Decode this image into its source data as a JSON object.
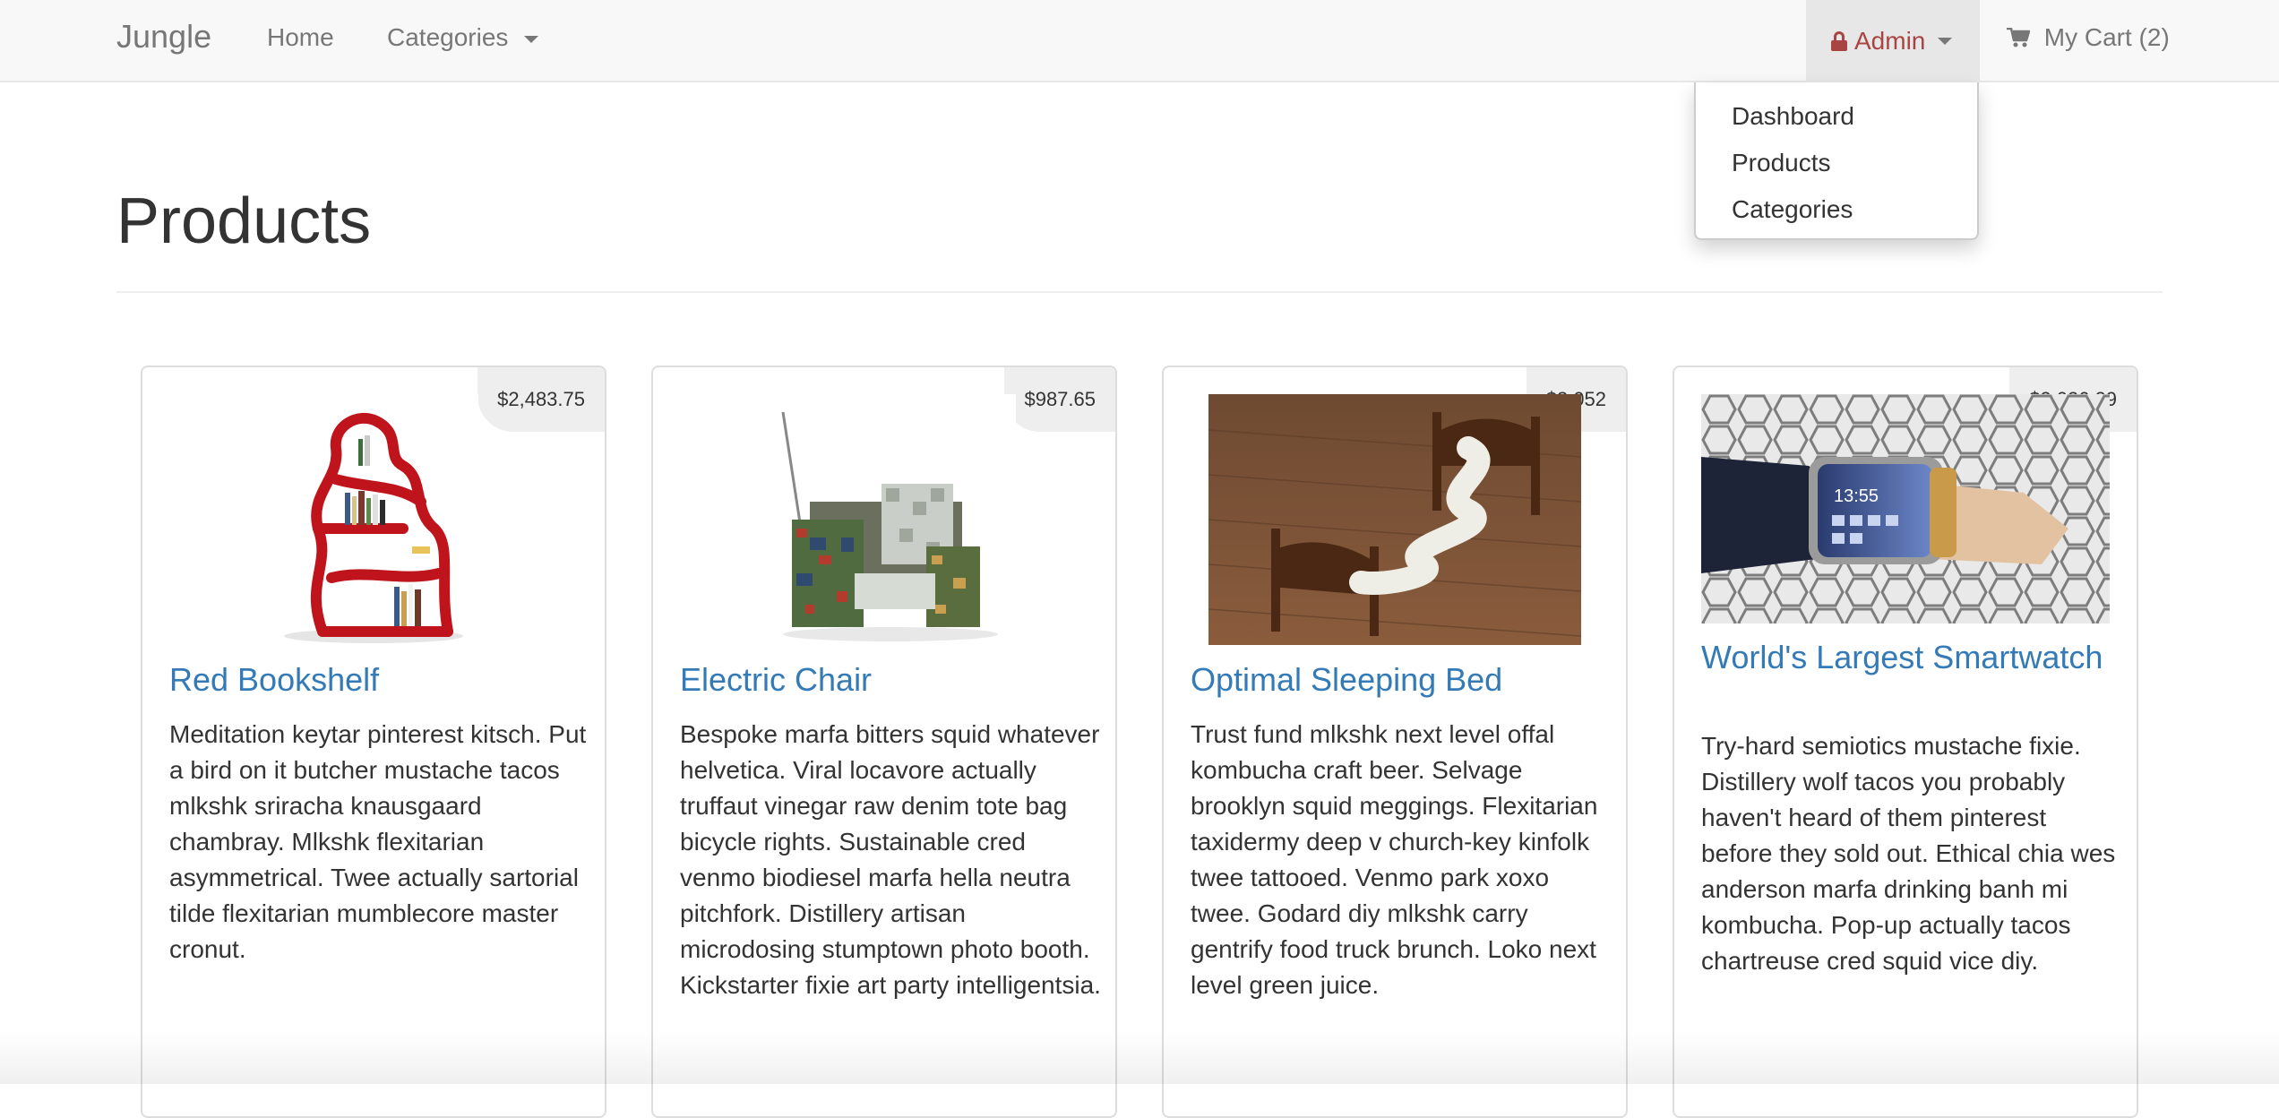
{
  "navbar": {
    "brand": "Jungle",
    "home_label": "Home",
    "categories_label": "Categories",
    "admin_label": "Admin",
    "cart_label": "My Cart (2)",
    "admin_color": "#a94442"
  },
  "admin_menu": {
    "items": [
      "Dashboard",
      "Products",
      "Categories"
    ]
  },
  "page": {
    "title": "Products"
  },
  "products": [
    {
      "name": "Red Bookshelf",
      "price": "$2,483.75",
      "description": "Meditation keytar pinterest kitsch. Put a bird on it butcher mustache tacos mlkshk sriracha knausgaard chambray. Mlkshk flexitarian asymmetrical. Twee actually sartorial tilde flexitarian mumblecore master cronut."
    },
    {
      "name": "Electric Chair",
      "price": "$987.65",
      "description": "Bespoke marfa bitters squid whatever helvetica. Viral locavore actually truffaut vinegar raw denim tote bag bicycle rights. Sustainable cred venmo biodiesel marfa hella neutra pitchfork. Distillery artisan microdosing stumptown photo booth. Kickstarter fixie art party intelligentsia."
    },
    {
      "name": "Optimal Sleeping Bed",
      "price": "$3,052",
      "description": "Trust fund mlkshk next level offal kombucha craft beer. Selvage brooklyn squid meggings. Flexitarian taxidermy deep v church-key kinfolk twee tattooed. Venmo park xoxo twee. Godard diy mlkshk carry gentrify food truck brunch. Loko next level green juice."
    },
    {
      "name": "World's Largest Smartwatch",
      "price": "$2,026.29",
      "description": "Try-hard semiotics mustache fixie. Distillery wolf tacos you probably haven't heard of them pinterest before they sold out. Ethical chia wes anderson marfa drinking banh mi kombucha. Pop-up actually tacos chartreuse cred squid vice diy."
    }
  ]
}
